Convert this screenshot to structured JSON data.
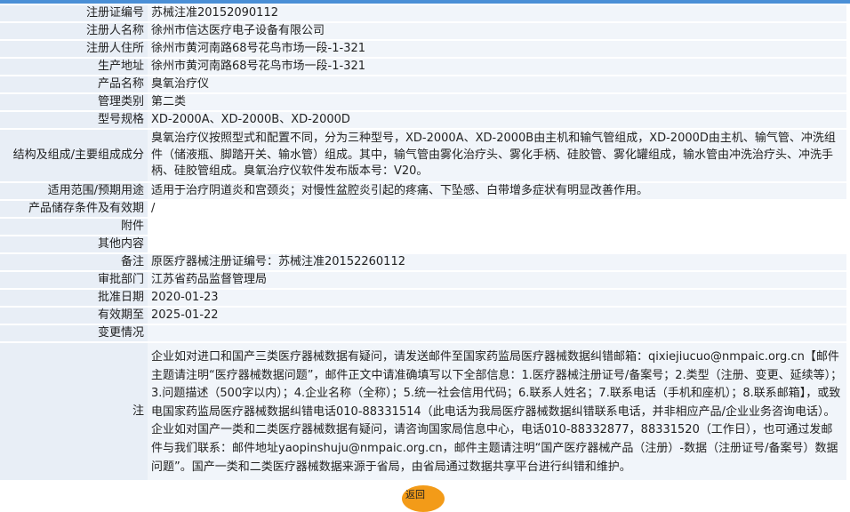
{
  "rows": [
    {
      "label": "注册证编号",
      "value": "苏械注准20152090112"
    },
    {
      "label": "注册人名称",
      "value": "徐州市信达医疗电子设备有限公司"
    },
    {
      "label": "注册人住所",
      "value": "徐州市黄河南路68号花鸟市场一段-1-321"
    },
    {
      "label": "生产地址",
      "value": "徐州市黄河南路68号花鸟市场一段-1-321"
    },
    {
      "label": "产品名称",
      "value": "臭氧治疗仪"
    },
    {
      "label": "管理类别",
      "value": "第二类"
    },
    {
      "label": "型号规格",
      "value": "XD-2000A、XD-2000B、XD-2000D"
    },
    {
      "label": "结构及组成/主要组成成分",
      "value": "臭氧治疗仪按照型式和配置不同，分为三种型号，XD-2000A、XD-2000B由主机和输气管组成，XD-2000D由主机、输气管、冲洗组件（储液瓶、脚踏开关、输水管）组成。其中，输气管由雾化治疗头、雾化手柄、硅胶管、雾化罐组成，输水管由冲洗治疗头、冲洗手柄、硅胶管组成。臭氧治疗仪软件发布版本号：V20。"
    },
    {
      "label": "适用范围/预期用途",
      "value": "适用于治疗阴道炎和宫颈炎；对慢性盆腔炎引起的疼痛、下坠感、白带增多症状有明显改善作用。"
    },
    {
      "label": "产品储存条件及有效期",
      "value": "/"
    },
    {
      "label": "附件",
      "value": ""
    },
    {
      "label": "其他内容",
      "value": ""
    },
    {
      "label": "备注",
      "value": "原医疗器械注册证编号：苏械注准20152260112"
    },
    {
      "label": "审批部门",
      "value": "江苏省药品监督管理局"
    },
    {
      "label": "批准日期",
      "value": "2020-01-23"
    },
    {
      "label": "有效期至",
      "value": "2025-01-22"
    },
    {
      "label": "变更情况",
      "value": ""
    }
  ],
  "notes": {
    "label": "注",
    "text": "企业如对进口和国产三类医疗器械数据有疑问，请发送邮件至国家药监局医疗器械数据纠错邮箱：qixiejiucuo@nmpaic.org.cn【邮件主题请注明“医疗器械数据问题”，邮件正文中请准确填写以下全部信息：1.医疗器械注册证号/备案号；2.类型（注册、变更、延续等）；3.问题描述（500字以内）；4.企业名称（全称）；5.统一社会信用代码；6.联系人姓名；7.联系电话（手机和座机）；8.联系邮箱】，或致电国家药监局医疗器械数据纠错电话010-88331514（此电话为我局医疗器械数据纠错联系电话，并非相应产品/企业业务咨询电话）。企业如对国产一类和二类医疗器械数据有疑问，请咨询国家局信息中心，电话010-88332877，88331520（工作日），也可通过发邮件与我们联系：邮件地址yaopinshuju@nmpaic.org.cn，邮件主题请注明“国产医疗器械产品（注册）-数据（注册证号/备案号）数据问题”。国产一类和二类医疗器械数据来源于省局，由省局通过数据共享平台进行纠错和维护。"
  },
  "return_button": {
    "label": "返回"
  },
  "colors": {
    "accent_bar": "#4a8fd6",
    "label_bg": "#e8eef6",
    "value_bg": "#f1f5fa",
    "button": "#f39b18"
  }
}
